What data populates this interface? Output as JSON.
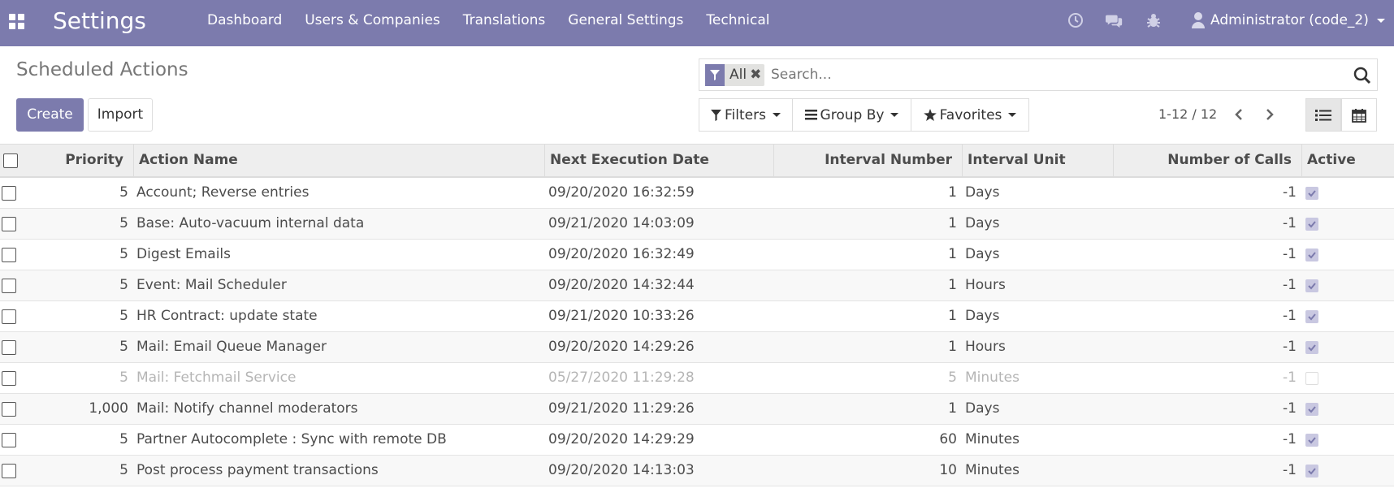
{
  "navbar": {
    "brand": "Settings",
    "menu": [
      "Dashboard",
      "Users & Companies",
      "Translations",
      "General Settings",
      "Technical"
    ],
    "user": "Administrator (code_2)",
    "color": "#7c7bad"
  },
  "page": {
    "title": "Scheduled Actions",
    "create_label": "Create",
    "import_label": "Import"
  },
  "search": {
    "facet_label": "All",
    "facet_close": "✖",
    "placeholder": "Search..."
  },
  "filters": {
    "filters_label": "Filters",
    "groupby_label": "Group By",
    "favorites_label": "Favorites"
  },
  "pager": {
    "value": "1-12 / 12"
  },
  "table": {
    "headers": {
      "priority": "Priority",
      "name": "Action Name",
      "next": "Next Execution Date",
      "interval_number": "Interval Number",
      "interval_unit": "Interval Unit",
      "calls": "Number of Calls",
      "active": "Active"
    },
    "rows": [
      {
        "priority": "5",
        "name": "Account; Reverse entries",
        "next": "09/20/2020 16:32:59",
        "interval_number": "1",
        "interval_unit": "Days",
        "calls": "-1",
        "active": true
      },
      {
        "priority": "5",
        "name": "Base: Auto-vacuum internal data",
        "next": "09/21/2020 14:03:09",
        "interval_number": "1",
        "interval_unit": "Days",
        "calls": "-1",
        "active": true
      },
      {
        "priority": "5",
        "name": "Digest Emails",
        "next": "09/20/2020 16:32:49",
        "interval_number": "1",
        "interval_unit": "Days",
        "calls": "-1",
        "active": true
      },
      {
        "priority": "5",
        "name": "Event: Mail Scheduler",
        "next": "09/20/2020 14:32:44",
        "interval_number": "1",
        "interval_unit": "Hours",
        "calls": "-1",
        "active": true
      },
      {
        "priority": "5",
        "name": "HR Contract: update state",
        "next": "09/21/2020 10:33:26",
        "interval_number": "1",
        "interval_unit": "Days",
        "calls": "-1",
        "active": true
      },
      {
        "priority": "5",
        "name": "Mail: Email Queue Manager",
        "next": "09/20/2020 14:29:26",
        "interval_number": "1",
        "interval_unit": "Hours",
        "calls": "-1",
        "active": true
      },
      {
        "priority": "5",
        "name": "Mail: Fetchmail Service",
        "next": "05/27/2020 11:29:28",
        "interval_number": "5",
        "interval_unit": "Minutes",
        "calls": "-1",
        "active": false
      },
      {
        "priority": "1,000",
        "name": "Mail: Notify channel moderators",
        "next": "09/21/2020 11:29:26",
        "interval_number": "1",
        "interval_unit": "Days",
        "calls": "-1",
        "active": true
      },
      {
        "priority": "5",
        "name": "Partner Autocomplete : Sync with remote DB",
        "next": "09/20/2020 14:29:29",
        "interval_number": "60",
        "interval_unit": "Minutes",
        "calls": "-1",
        "active": true
      },
      {
        "priority": "5",
        "name": "Post process payment transactions",
        "next": "09/20/2020 14:13:03",
        "interval_number": "10",
        "interval_unit": "Minutes",
        "calls": "-1",
        "active": true
      }
    ]
  }
}
